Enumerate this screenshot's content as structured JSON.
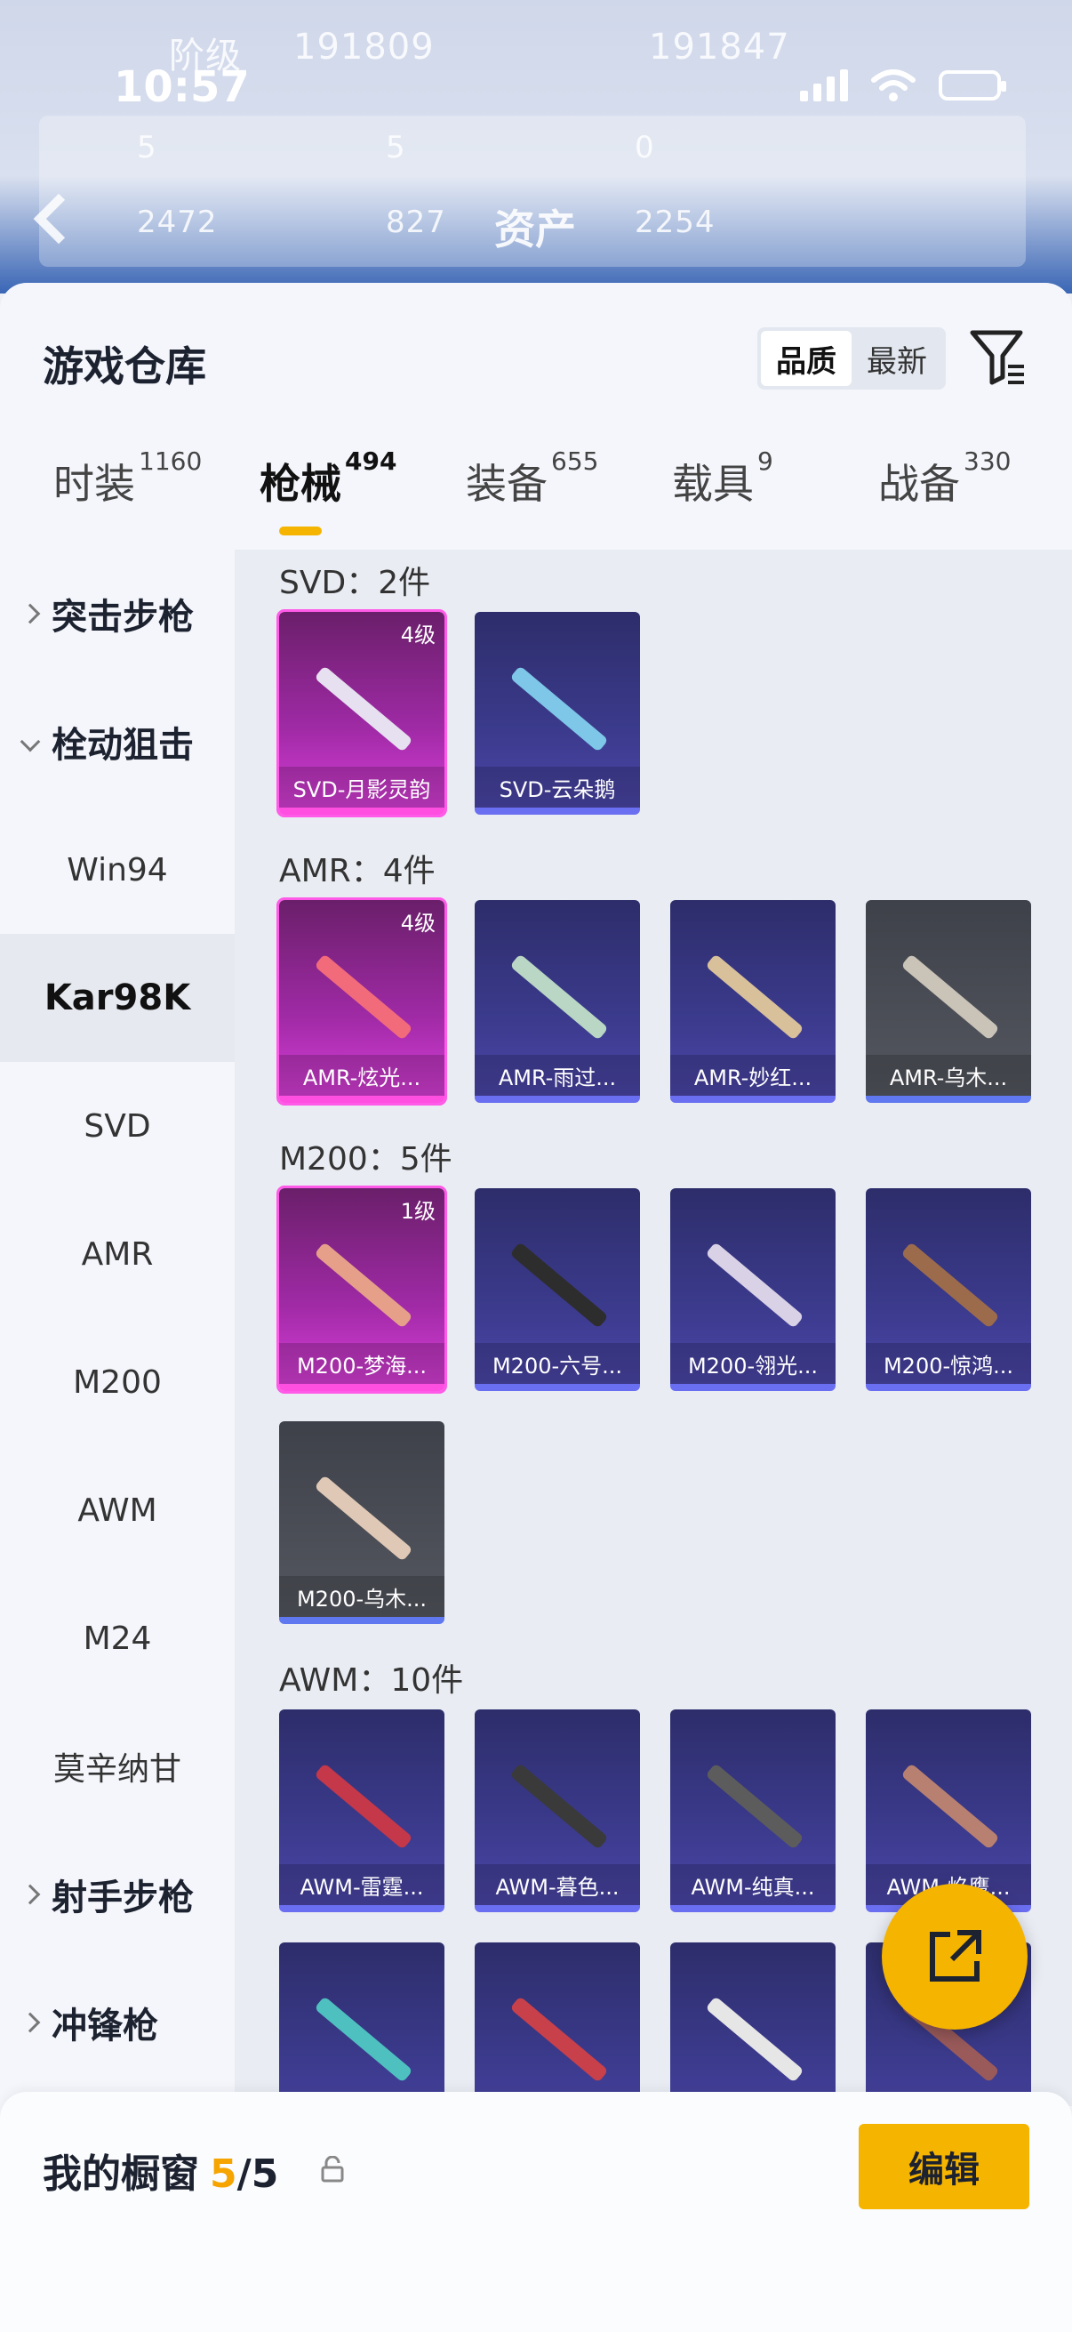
{
  "status_bar": {
    "time": "10:57"
  },
  "background": {
    "level_text": "阶级",
    "score_a": "191809",
    "score_b": "191847",
    "stat_1": "5",
    "stat_2": "5",
    "stat_3": "0",
    "stat_4": "2472",
    "stat_5": "827",
    "stat_6": "2254",
    "page_title": "资产"
  },
  "sheet": {
    "title": "游戏仓库",
    "sort_options": [
      "品质",
      "最新"
    ],
    "sort_active": "品质"
  },
  "tabs": [
    {
      "label": "时装",
      "count": "1160"
    },
    {
      "label": "枪械",
      "count": "494",
      "active": true
    },
    {
      "label": "装备",
      "count": "655"
    },
    {
      "label": "载具",
      "count": "9"
    },
    {
      "label": "战备",
      "count": "330"
    }
  ],
  "sidebar": [
    {
      "label": "突击步枪",
      "type": "group",
      "expanded": false
    },
    {
      "label": "栓动狙击",
      "type": "group",
      "expanded": true
    },
    {
      "label": "Win94",
      "type": "item"
    },
    {
      "label": "Kar98K",
      "type": "item",
      "selected": true
    },
    {
      "label": "SVD",
      "type": "item"
    },
    {
      "label": "AMR",
      "type": "item"
    },
    {
      "label": "M200",
      "type": "item"
    },
    {
      "label": "AWM",
      "type": "item"
    },
    {
      "label": "M24",
      "type": "item"
    },
    {
      "label": "莫辛纳甘",
      "type": "item"
    },
    {
      "label": "射手步枪",
      "type": "group",
      "expanded": false
    },
    {
      "label": "冲锋枪",
      "type": "group",
      "expanded": false
    }
  ],
  "groups": [
    {
      "title": "SVD：2件",
      "items": [
        {
          "name": "SVD-月影灵韵",
          "level": "4级",
          "rarity": "pink"
        },
        {
          "name": "SVD-云朵鹅",
          "rarity": "purple"
        }
      ]
    },
    {
      "title": "AMR：4件",
      "items": [
        {
          "name": "AMR-炫光...",
          "level": "4级",
          "rarity": "pink"
        },
        {
          "name": "AMR-雨过...",
          "rarity": "purple"
        },
        {
          "name": "AMR-妙红...",
          "rarity": "purple"
        },
        {
          "name": "AMR-乌木...",
          "rarity": "gray"
        }
      ]
    },
    {
      "title": "M200：5件",
      "items": [
        {
          "name": "M200-梦海...",
          "level": "1级",
          "rarity": "pink"
        },
        {
          "name": "M200-六号...",
          "rarity": "purple"
        },
        {
          "name": "M200-翎光...",
          "rarity": "purple"
        },
        {
          "name": "M200-惊鸿...",
          "rarity": "purple"
        },
        {
          "name": "M200-乌木...",
          "rarity": "gray"
        }
      ]
    },
    {
      "title": "AWM：10件",
      "items": [
        {
          "name": "AWM-雷霆...",
          "rarity": "purple"
        },
        {
          "name": "AWM-暮色...",
          "rarity": "purple"
        },
        {
          "name": "AWM-纯真...",
          "rarity": "purple"
        },
        {
          "name": "AWM-焰鹰...",
          "rarity": "purple"
        },
        {
          "name": "",
          "rarity": "purple"
        },
        {
          "name": "",
          "rarity": "purple"
        },
        {
          "name": "",
          "rarity": "purple"
        },
        {
          "name": "",
          "rarity": "purple"
        }
      ]
    }
  ],
  "showcase": {
    "label": "我的橱窗",
    "current": "5",
    "total": "/5",
    "edit_label": "编辑"
  },
  "colors": {
    "accent": "#f5b400",
    "pink": "#d63ed6",
    "purple": "#4b46a8",
    "gray": "#54575f"
  }
}
